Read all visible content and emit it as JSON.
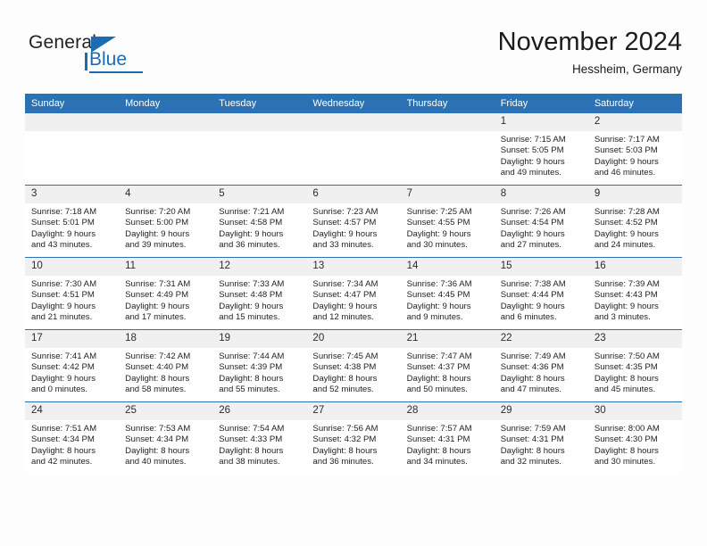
{
  "brand": {
    "name_top": "General",
    "name_bottom": "Blue"
  },
  "header": {
    "title": "November 2024",
    "location": "Hessheim, Germany",
    "accent_color": "#2b72b4",
    "daynum_band_color": "#f0f0f0"
  },
  "calendar": {
    "weekday_headers": [
      "Sunday",
      "Monday",
      "Tuesday",
      "Wednesday",
      "Thursday",
      "Friday",
      "Saturday"
    ],
    "weeks": [
      [
        {
          "day": "",
          "lines": [
            "",
            "",
            "",
            ""
          ]
        },
        {
          "day": "",
          "lines": [
            "",
            "",
            "",
            ""
          ]
        },
        {
          "day": "",
          "lines": [
            "",
            "",
            "",
            ""
          ]
        },
        {
          "day": "",
          "lines": [
            "",
            "",
            "",
            ""
          ]
        },
        {
          "day": "",
          "lines": [
            "",
            "",
            "",
            ""
          ]
        },
        {
          "day": "1",
          "lines": [
            "Sunrise: 7:15 AM",
            "Sunset: 5:05 PM",
            "Daylight: 9 hours",
            "and 49 minutes."
          ]
        },
        {
          "day": "2",
          "lines": [
            "Sunrise: 7:17 AM",
            "Sunset: 5:03 PM",
            "Daylight: 9 hours",
            "and 46 minutes."
          ]
        }
      ],
      [
        {
          "day": "3",
          "lines": [
            "Sunrise: 7:18 AM",
            "Sunset: 5:01 PM",
            "Daylight: 9 hours",
            "and 43 minutes."
          ]
        },
        {
          "day": "4",
          "lines": [
            "Sunrise: 7:20 AM",
            "Sunset: 5:00 PM",
            "Daylight: 9 hours",
            "and 39 minutes."
          ]
        },
        {
          "day": "5",
          "lines": [
            "Sunrise: 7:21 AM",
            "Sunset: 4:58 PM",
            "Daylight: 9 hours",
            "and 36 minutes."
          ]
        },
        {
          "day": "6",
          "lines": [
            "Sunrise: 7:23 AM",
            "Sunset: 4:57 PM",
            "Daylight: 9 hours",
            "and 33 minutes."
          ]
        },
        {
          "day": "7",
          "lines": [
            "Sunrise: 7:25 AM",
            "Sunset: 4:55 PM",
            "Daylight: 9 hours",
            "and 30 minutes."
          ]
        },
        {
          "day": "8",
          "lines": [
            "Sunrise: 7:26 AM",
            "Sunset: 4:54 PM",
            "Daylight: 9 hours",
            "and 27 minutes."
          ]
        },
        {
          "day": "9",
          "lines": [
            "Sunrise: 7:28 AM",
            "Sunset: 4:52 PM",
            "Daylight: 9 hours",
            "and 24 minutes."
          ]
        }
      ],
      [
        {
          "day": "10",
          "lines": [
            "Sunrise: 7:30 AM",
            "Sunset: 4:51 PM",
            "Daylight: 9 hours",
            "and 21 minutes."
          ]
        },
        {
          "day": "11",
          "lines": [
            "Sunrise: 7:31 AM",
            "Sunset: 4:49 PM",
            "Daylight: 9 hours",
            "and 17 minutes."
          ]
        },
        {
          "day": "12",
          "lines": [
            "Sunrise: 7:33 AM",
            "Sunset: 4:48 PM",
            "Daylight: 9 hours",
            "and 15 minutes."
          ]
        },
        {
          "day": "13",
          "lines": [
            "Sunrise: 7:34 AM",
            "Sunset: 4:47 PM",
            "Daylight: 9 hours",
            "and 12 minutes."
          ]
        },
        {
          "day": "14",
          "lines": [
            "Sunrise: 7:36 AM",
            "Sunset: 4:45 PM",
            "Daylight: 9 hours",
            "and 9 minutes."
          ]
        },
        {
          "day": "15",
          "lines": [
            "Sunrise: 7:38 AM",
            "Sunset: 4:44 PM",
            "Daylight: 9 hours",
            "and 6 minutes."
          ]
        },
        {
          "day": "16",
          "lines": [
            "Sunrise: 7:39 AM",
            "Sunset: 4:43 PM",
            "Daylight: 9 hours",
            "and 3 minutes."
          ]
        }
      ],
      [
        {
          "day": "17",
          "lines": [
            "Sunrise: 7:41 AM",
            "Sunset: 4:42 PM",
            "Daylight: 9 hours",
            "and 0 minutes."
          ]
        },
        {
          "day": "18",
          "lines": [
            "Sunrise: 7:42 AM",
            "Sunset: 4:40 PM",
            "Daylight: 8 hours",
            "and 58 minutes."
          ]
        },
        {
          "day": "19",
          "lines": [
            "Sunrise: 7:44 AM",
            "Sunset: 4:39 PM",
            "Daylight: 8 hours",
            "and 55 minutes."
          ]
        },
        {
          "day": "20",
          "lines": [
            "Sunrise: 7:45 AM",
            "Sunset: 4:38 PM",
            "Daylight: 8 hours",
            "and 52 minutes."
          ]
        },
        {
          "day": "21",
          "lines": [
            "Sunrise: 7:47 AM",
            "Sunset: 4:37 PM",
            "Daylight: 8 hours",
            "and 50 minutes."
          ]
        },
        {
          "day": "22",
          "lines": [
            "Sunrise: 7:49 AM",
            "Sunset: 4:36 PM",
            "Daylight: 8 hours",
            "and 47 minutes."
          ]
        },
        {
          "day": "23",
          "lines": [
            "Sunrise: 7:50 AM",
            "Sunset: 4:35 PM",
            "Daylight: 8 hours",
            "and 45 minutes."
          ]
        }
      ],
      [
        {
          "day": "24",
          "lines": [
            "Sunrise: 7:51 AM",
            "Sunset: 4:34 PM",
            "Daylight: 8 hours",
            "and 42 minutes."
          ]
        },
        {
          "day": "25",
          "lines": [
            "Sunrise: 7:53 AM",
            "Sunset: 4:34 PM",
            "Daylight: 8 hours",
            "and 40 minutes."
          ]
        },
        {
          "day": "26",
          "lines": [
            "Sunrise: 7:54 AM",
            "Sunset: 4:33 PM",
            "Daylight: 8 hours",
            "and 38 minutes."
          ]
        },
        {
          "day": "27",
          "lines": [
            "Sunrise: 7:56 AM",
            "Sunset: 4:32 PM",
            "Daylight: 8 hours",
            "and 36 minutes."
          ]
        },
        {
          "day": "28",
          "lines": [
            "Sunrise: 7:57 AM",
            "Sunset: 4:31 PM",
            "Daylight: 8 hours",
            "and 34 minutes."
          ]
        },
        {
          "day": "29",
          "lines": [
            "Sunrise: 7:59 AM",
            "Sunset: 4:31 PM",
            "Daylight: 8 hours",
            "and 32 minutes."
          ]
        },
        {
          "day": "30",
          "lines": [
            "Sunrise: 8:00 AM",
            "Sunset: 4:30 PM",
            "Daylight: 8 hours",
            "and 30 minutes."
          ]
        }
      ]
    ]
  }
}
